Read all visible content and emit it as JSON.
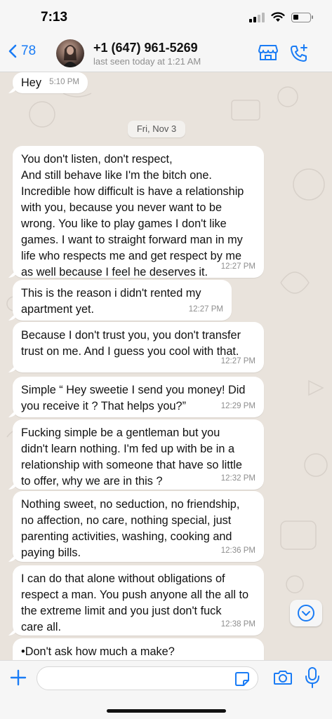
{
  "status": {
    "time": "7:13"
  },
  "header": {
    "back_count": "78",
    "contact_name": "+1 (647) 961-5269",
    "last_seen": "last seen today at 1:21 AM"
  },
  "date_separator": "Fri, Nov 3",
  "messages": [
    {
      "text": "Hey",
      "time": "5:10 PM"
    },
    {
      "text": "You don't listen, don't respect,\nAnd still behave like I'm the bitch one.\nIncredible how difficult is have a relationship\nwith you, because you never want to be\nwrong. You like to play games I don't like\ngames. I want to straight forward man in my\nlife who respects me and get respect by me\nas well because I feel he deserves it.",
      "time": "12:27 PM"
    },
    {
      "text": "This is the reason i didn't rented my\napartment yet.",
      "time": "12:27 PM"
    },
    {
      "text": "Because I don't trust you, you don't transfer\ntrust on me. And I guess you cool with that.",
      "time": "12:27 PM"
    },
    {
      "text": "Simple “ Hey sweetie I send you money! Did\nyou receive it ? That helps you?”",
      "time": "12:29 PM"
    },
    {
      "text": "Fucking simple be a gentleman but you\ndidn't learn nothing. I'm fed up with be in a\nrelationship with someone that have so little\nto offer, why we are in this ?",
      "time": "12:32 PM"
    },
    {
      "text": "Nothing sweet, no seduction, no friendship,\nno affection, no care, nothing special, just\nparenting activities, washing, cooking and\npaying bills.",
      "time": "12:36 PM"
    },
    {
      "text": "I can do that alone without obligations of\nrespect a man. You push anyone all the all to\nthe extreme limit and you just don't fuck\ncare all.",
      "time": "12:38 PM"
    },
    {
      "text": "•Don't ask how much a make?",
      "time": ""
    }
  ],
  "input": {
    "placeholder": "",
    "value": ""
  },
  "icons": {
    "back": "chevron-left-icon",
    "store": "store-icon",
    "add_call": "phone-plus-icon",
    "plus": "plus-icon",
    "sticker": "sticker-icon",
    "camera": "camera-icon",
    "mic": "microphone-icon",
    "scroll": "chevron-down-icon"
  },
  "colors": {
    "accent": "#1a7cf5",
    "bubble": "#ffffff",
    "wallpaper": "#e9e3dc"
  }
}
